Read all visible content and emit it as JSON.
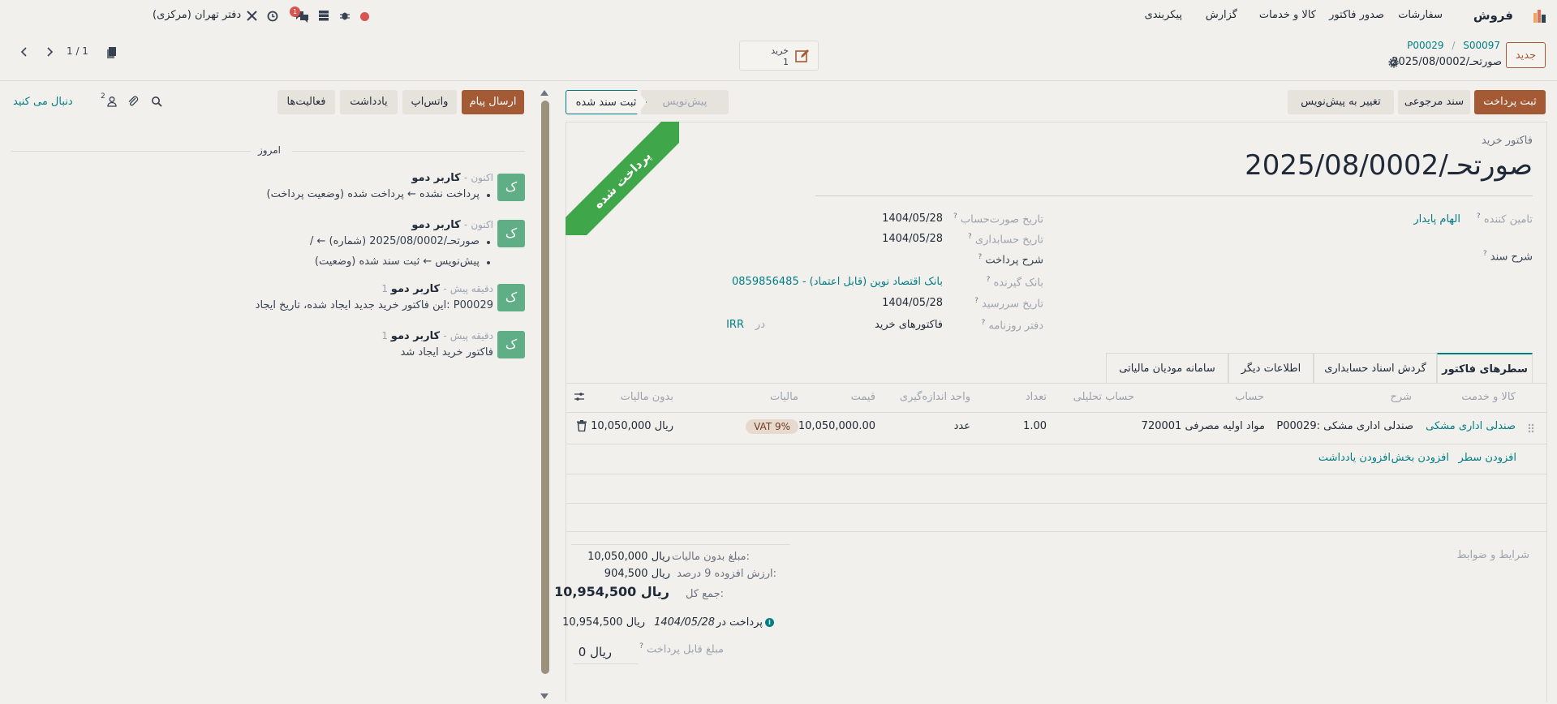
{
  "nav": {
    "app_name": "فروش",
    "menus": [
      "سفارشات",
      "صدور فاکتور",
      "کالا و خدمات",
      "گزارش",
      "پیکربندی"
    ],
    "company": "دفتر تهران (مرکزی)",
    "chat_badge": "1"
  },
  "control": {
    "new_label": "جدید",
    "breadcrumb_parent": "S00097",
    "breadcrumb_sep": "/",
    "breadcrumb_child": "P00029",
    "record_name": "صورتحـ/2025/08/0002",
    "purchase_label": "خرید",
    "purchase_count": "1",
    "pager": "1 / 1"
  },
  "actions": {
    "register_payment": "ثبت پرداخت",
    "credit_note": "سند مرجوعی",
    "reset_draft": "تغییر به پیش‌نویس",
    "status_draft": "پیش‌نویس",
    "status_posted": "ثبت سند شده"
  },
  "chatter_actions": {
    "send_message": "ارسال پیام",
    "whatsapp": "واتس‌اپ",
    "note": "یادداشت",
    "activities": "فعالیت‌ها",
    "followers_count": "2",
    "follow": "دنبال می کنید"
  },
  "form": {
    "ribbon": "پرداخت شده",
    "doc_type": "فاکتور خرید",
    "title": "صورتحـ/2025/08/0002",
    "vendor_label": "تامین کننده",
    "vendor_value": "الهام پایدار",
    "ref_label": "شرح سند",
    "invoice_date_label": "تاریخ صورت‌حساب",
    "invoice_date": "1404/05/28",
    "accounting_date_label": "تاریخ حسابداری",
    "accounting_date": "1404/05/28",
    "payment_ref_label": "شرح پرداخت",
    "bank_label": "بانک گیرنده",
    "bank_value": "0859856485 - بانک اقتصاد نوین (قابل اعتماد)",
    "due_date_label": "تاریخ سررسید",
    "due_date": "1404/05/28",
    "journal_label": "دفتر روزنامه",
    "journal_value": "فاکتورهای خرید",
    "currency_in": "در",
    "currency": "IRR"
  },
  "tabs": [
    "سطرهای فاکتور",
    "گردش اسناد حسابداری",
    "اطلاعات دیگر",
    "سامانه مودیان مالیاتی"
  ],
  "table": {
    "headers": {
      "product": "کالا و خدمت",
      "label": "شرح",
      "account": "حساب",
      "analytic": "حساب تحلیلی",
      "quantity": "تعداد",
      "uom": "واحد اندازه‌گیری",
      "price": "قیمت",
      "taxes": "مالیات",
      "subtotal": "بدون مالیات"
    },
    "rows": [
      {
        "product": "صندلی اداری مشکی",
        "label": "P00029: صندلی اداری مشکی",
        "account": "720001 مواد اولیه مصرفی",
        "quantity": "1.00",
        "uom": "عدد",
        "price": "10,050,000.00",
        "tax": "VAT 9%",
        "subtotal": "10,050,000 ریال"
      }
    ],
    "add_line": "افزودن سطر",
    "add_section": "افزودن بخش",
    "add_note": "افزودن یادداشت"
  },
  "totals": {
    "terms_placeholder": "شرایط و ضوابط",
    "untaxed_label": "مبلغ بدون مالیات:",
    "untaxed_value": "10,050,000 ریال",
    "vat_label": "ارزش افزوده 9 درصد:",
    "vat_value": "904,500 ریال",
    "total_label": "جمع کل:",
    "total_value": "10,954,500 ریال",
    "paid_label": "پرداخت در",
    "paid_date": "1404/05/28",
    "paid_value": "10,954,500 ریال",
    "due_label": "مبلغ قابل پرداخت",
    "due_value": "0 ریال"
  },
  "chatter": {
    "today": "امروز",
    "messages": [
      {
        "avatar": "ک",
        "author": "کاربر دمو",
        "time": "اکنون",
        "lines": [
          "پرداخت نشده ← پرداخت شده (وضعیت پرداخت)"
        ]
      },
      {
        "avatar": "ک",
        "author": "کاربر دمو",
        "time": "اکنون",
        "lines": [
          "/ ← صورتحـ/2025/08/0002 (شماره)",
          "پیش‌نویس ← ثبت سند شده (وضعیت)"
        ]
      },
      {
        "avatar": "ک",
        "author": "کاربر دمو",
        "time": "1 دقیقه پیش",
        "lines": [
          "این فاکتور خرید جدید ایجاد شده، تاریخ ایجاد: P00029"
        ]
      },
      {
        "avatar": "ک",
        "author": "کاربر دمو",
        "time": "1 دقیقه پیش",
        "lines": [
          "فاکتور خرید ایجاد شد"
        ]
      }
    ]
  },
  "colors": {
    "primary": "#a45a35",
    "ribbon": "#3fa64a",
    "link": "#017e84",
    "background": "#f1f0ec"
  }
}
